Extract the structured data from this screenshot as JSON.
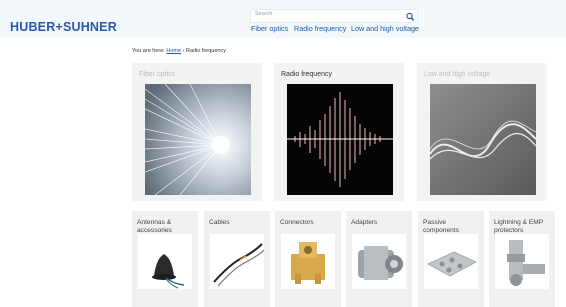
{
  "header": {
    "logo": "HUBER+SUHNER",
    "search": {
      "placeholder": "Search"
    },
    "nav": [
      "Fiber optics",
      "Radio frequency",
      "Low and high voltage"
    ]
  },
  "breadcrumb": {
    "prefix": "You are here:",
    "home": "Home",
    "separator": " › ",
    "current": "Radio frequency"
  },
  "categories": [
    {
      "label": "Fiber optics",
      "active": false
    },
    {
      "label": "Radio frequency",
      "active": true
    },
    {
      "label": "Low and high voltage",
      "active": false
    }
  ],
  "subcategories": [
    {
      "label": "Antennas & accessories"
    },
    {
      "label": "Cables"
    },
    {
      "label": "Connectors"
    },
    {
      "label": "Adapters"
    },
    {
      "label": "Passive components"
    },
    {
      "label": "Lightning & EMP protectors"
    }
  ],
  "colors": {
    "brand": "#2a5aa7",
    "header_bg": "#f2f8fc",
    "tile_bg": "#f3f3f3"
  }
}
